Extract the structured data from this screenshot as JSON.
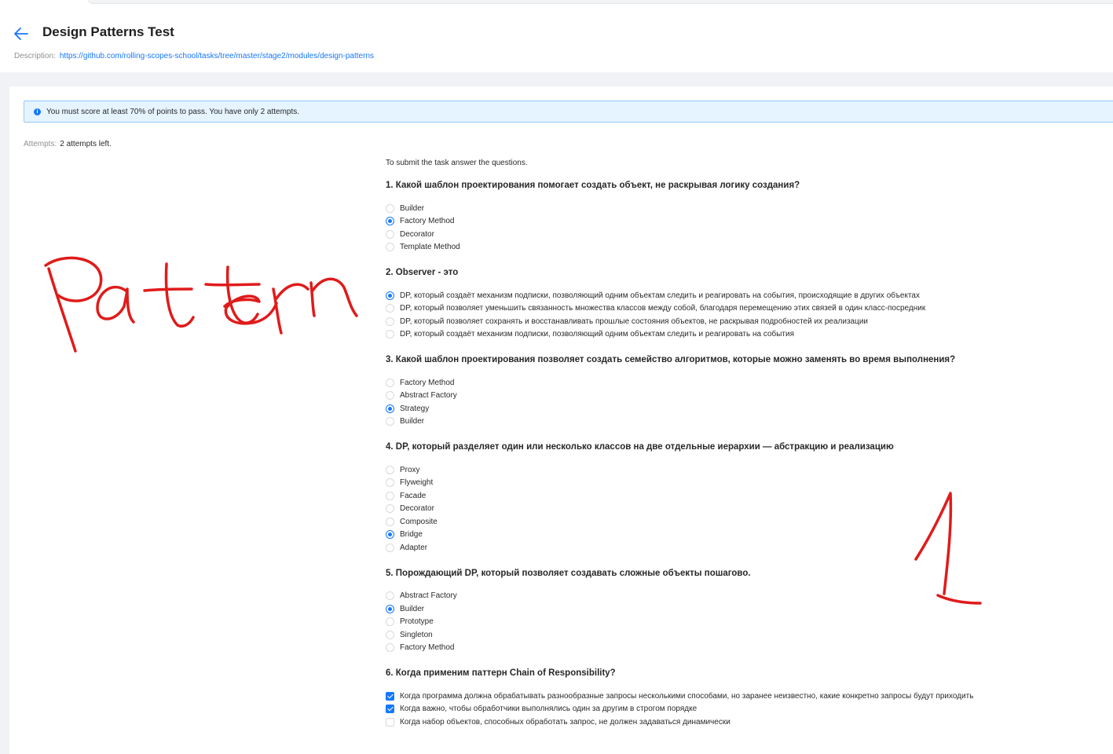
{
  "header": {
    "title": "Design Patterns Test",
    "description_label": "Description:",
    "description_link": "https://github.com/rolling-scopes-school/tasks/tree/master/stage2/modules/design-patterns"
  },
  "alert": {
    "text": "You must score at least 70% of points to pass. You have only 2 attempts."
  },
  "attempts": {
    "label": "Attempts:",
    "value": "2 attempts left."
  },
  "intro": "To submit the task answer the questions.",
  "questions": [
    {
      "title": "1. Какой шаблон проектирования помогает создать объект, не раскрывая логику создания?",
      "type": "radio",
      "options": [
        {
          "label": "Builder",
          "checked": false
        },
        {
          "label": "Factory Method",
          "checked": true
        },
        {
          "label": "Decorator",
          "checked": false
        },
        {
          "label": "Template Method",
          "checked": false
        }
      ]
    },
    {
      "title": "2. Observer - это",
      "type": "radio",
      "options": [
        {
          "label": "DP, который создаёт механизм подписки, позволяющий одним объектам следить и реагировать на события, происходящие в других объектах",
          "checked": true
        },
        {
          "label": "DP, который позволяет уменьшить связанность множества классов между собой, благодаря перемещению этих связей в один класс-посредник",
          "checked": false
        },
        {
          "label": "DP, который позволяет сохранять и восстанавливать прошлые состояния объектов, не раскрывая подробностей их реализации",
          "checked": false
        },
        {
          "label": "DP, который создаёт механизм подписки, позволяющий одним объектам следить и реагировать на события",
          "checked": false
        }
      ]
    },
    {
      "title": "3. Какой шаблон проектирования позволяет создать семейство алгоритмов, которые можно заменять во время выполнения?",
      "type": "radio",
      "options": [
        {
          "label": "Factory Method",
          "checked": false
        },
        {
          "label": "Abstract Factory",
          "checked": false
        },
        {
          "label": "Strategy",
          "checked": true
        },
        {
          "label": "Builder",
          "checked": false
        }
      ]
    },
    {
      "title": "4. DP, который разделяет один или несколько классов на две отдельные иерархии — абстракцию и реализацию",
      "type": "radio",
      "options": [
        {
          "label": "Proxy",
          "checked": false
        },
        {
          "label": "Flyweight",
          "checked": false
        },
        {
          "label": "Facade",
          "checked": false
        },
        {
          "label": "Decorator",
          "checked": false
        },
        {
          "label": "Composite",
          "checked": false
        },
        {
          "label": "Bridge",
          "checked": true
        },
        {
          "label": "Adapter",
          "checked": false
        }
      ]
    },
    {
      "title": "5. Порождающий DP, который позволяет создавать сложные объекты пошагово.",
      "type": "radio",
      "options": [
        {
          "label": "Abstract Factory",
          "checked": false
        },
        {
          "label": "Builder",
          "checked": true
        },
        {
          "label": "Prototype",
          "checked": false
        },
        {
          "label": "Singleton",
          "checked": false
        },
        {
          "label": "Factory Method",
          "checked": false
        }
      ]
    },
    {
      "title": "6. Когда применим паттерн Chain of Responsibility?",
      "type": "checkbox",
      "options": [
        {
          "label": "Когда программа должна обрабатывать разнообразные запросы несколькими способами, но заранее неизвестно, какие конкретно запросы будут приходить",
          "checked": true
        },
        {
          "label": "Когда важно, чтобы обработчики выполнялись один за другим в строгом порядке",
          "checked": true
        },
        {
          "label": "Когда набор объектов, способных обработать запрос, не должен задаваться динамически",
          "checked": false
        }
      ]
    }
  ],
  "colors": {
    "accent": "#1677ff",
    "ink": "#e01b1b",
    "alert_bg": "#e6f4ff"
  },
  "icons": {
    "back": "arrow-left-icon",
    "info": "info-circle-icon"
  }
}
